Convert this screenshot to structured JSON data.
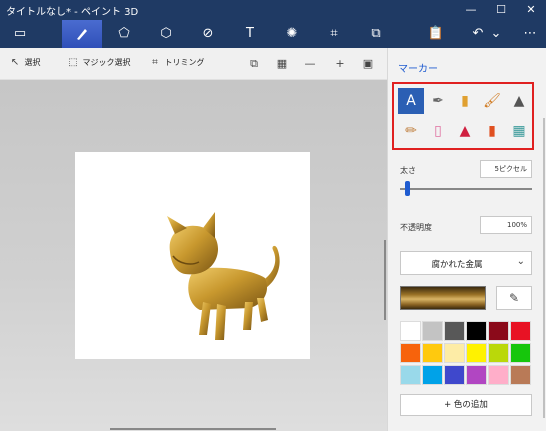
{
  "window": {
    "title": "タイトルなし* - ペイント 3D",
    "minimize": "—",
    "maximize": "☐",
    "close": "✕"
  },
  "toolbar": {
    "menu": "▭",
    "brushes": "🖌",
    "shapes2d": "⬠",
    "shapes3d": "⬡",
    "stickers": "⊘",
    "text": "T",
    "effects": "✺",
    "crop": "⌗",
    "library": "⧉",
    "paste": "📋",
    "undo": "↶",
    "history": "⌄",
    "more": "⋯"
  },
  "subbar": {
    "select_label": "選択",
    "magic_select_label": "マジック選択",
    "crop_label": "トリミング",
    "icons": {
      "select": "select-cursor-icon",
      "magic_select": "magic-select-icon",
      "crop": "crop-icon",
      "view3d": "view-3d-icon",
      "grid": "grid-icon",
      "zoom_out": "zoom-out-icon",
      "zoom_in": "zoom-in-icon",
      "image": "image-icon"
    }
  },
  "panel": {
    "title": "マーカー",
    "size_label": "太さ",
    "size_value": "5ピクセル",
    "opacity_label": "不透明度",
    "opacity_value": "100%",
    "texture": "腐かれた金属",
    "add_color": "色の追加",
    "add_color_icon": "+",
    "eyedropper": "eyedropper-icon",
    "size_level": 0.05,
    "brushes": [
      {
        "name": "marker",
        "icon": "marker-icon",
        "color": "#1e5bd0",
        "selected": true
      },
      {
        "name": "calligraphy-pen",
        "icon": "calligraphy-pen-icon",
        "color": "#666666"
      },
      {
        "name": "oil-brush",
        "icon": "oil-brush-icon",
        "color": "#e0a030"
      },
      {
        "name": "watercolor",
        "icon": "watercolor-brush-icon",
        "color": "#d07a20"
      },
      {
        "name": "pixel-pen",
        "icon": "pixel-pen-icon",
        "color": "#555555"
      },
      {
        "name": "pencil",
        "icon": "pencil-icon",
        "color": "#c08040"
      },
      {
        "name": "eraser",
        "icon": "eraser-icon",
        "color": "#e070a0"
      },
      {
        "name": "crayon",
        "icon": "crayon-icon",
        "color": "#d02040"
      },
      {
        "name": "spray-can",
        "icon": "spray-can-icon",
        "color": "#e05020"
      },
      {
        "name": "fill",
        "icon": "fill-bucket-icon",
        "color": "#3a9a9a"
      }
    ],
    "palette": [
      "#ffffff",
      "#c3c3c3",
      "#585858",
      "#000000",
      "#8b0a1a",
      "#e81224",
      "#f7630c",
      "#ffc90e",
      "#fdeca6",
      "#fff200",
      "#bad80a",
      "#16c60c",
      "#99d9ea",
      "#00a2e8",
      "#3f48cc",
      "#b146c2",
      "#ffaec9",
      "#b97a57"
    ]
  },
  "colors": {
    "titlebar": "#1f3a64",
    "accent": "#1e5bd0",
    "highlight_frame": "#e02020"
  }
}
